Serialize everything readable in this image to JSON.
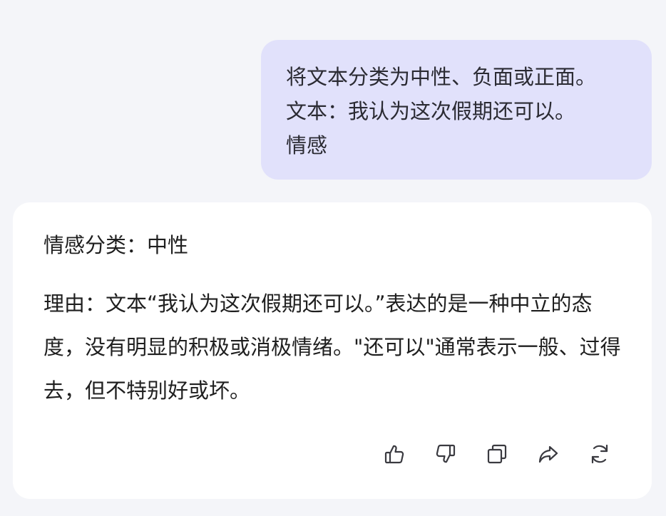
{
  "user_message": {
    "lines": [
      "将文本分类为中性、负面或正面。",
      "文本：我认为这次假期还可以。",
      "情感"
    ]
  },
  "assistant_message": {
    "classification": "情感分类：中性",
    "reason": "理由：文本“我认为这次假期还可以。”表达的是一种中立的态度，没有明显的积极或消极情绪。\"还可以\"通常表示一般、过得去，但不特别好或坏。"
  },
  "actions": {
    "icons": [
      "thumbs-up-icon",
      "thumbs-down-icon",
      "copy-icon",
      "share-icon",
      "regenerate-icon"
    ]
  },
  "colors": {
    "background": "#f4f5f9",
    "user_bubble": "#e1e1fb",
    "assistant_card": "#ffffff",
    "icon": "#3a3a40"
  }
}
